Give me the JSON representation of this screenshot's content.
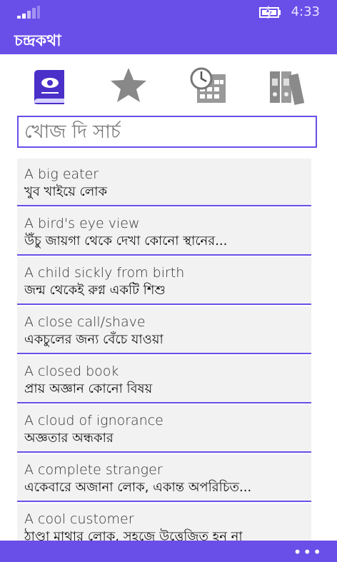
{
  "status": {
    "time": "4:33"
  },
  "app": {
    "title": "চন্দ্রকথা"
  },
  "tabs": [
    {
      "icon": "book-icon"
    },
    {
      "icon": "star-icon"
    },
    {
      "icon": "calendar-clock-icon"
    },
    {
      "icon": "binders-icon"
    }
  ],
  "search": {
    "placeholder": "খোজ দি সার্চ"
  },
  "items": [
    {
      "en": "A big eater",
      "bn": "খুব খাইয়ে লোক"
    },
    {
      "en": "A bird's eye view",
      "bn": "উঁচু জায়গা থেকে দেখা কোনো স্থানের..."
    },
    {
      "en": "A child sickly from birth",
      "bn": "জন্ম থেকেই রুগ্ন একটি শিশু"
    },
    {
      "en": "A close call/shave",
      "bn": "একচুলের জন্য বেঁচে যাওয়া"
    },
    {
      "en": "A closed book",
      "bn": "প্রায় অজ্ঞান কোনো বিষয়"
    },
    {
      "en": "A cloud of ignorance",
      "bn": "অজ্ঞতার অন্ধকার"
    },
    {
      "en": "A complete stranger",
      "bn": "একেবারে অজানা লোক, একান্ত অপরিচিত..."
    },
    {
      "en": "A cool customer",
      "bn": "ঠাণ্ডা মাথার লোক, সহজে উত্তেজিত হন না"
    }
  ],
  "appbar": {
    "more_label": "•••"
  },
  "colors": {
    "accent": "#6a4ee8",
    "item_bg": "#f2f2f2"
  }
}
